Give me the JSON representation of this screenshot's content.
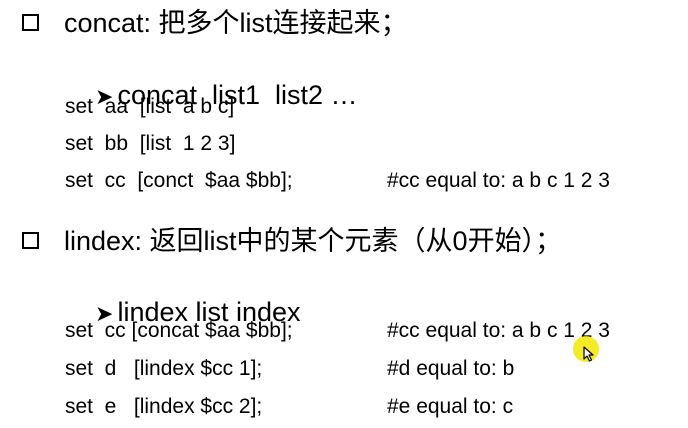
{
  "section1": {
    "heading": "concat: 把多个list连接起来；",
    "syntax": "concat  list1  list2 …",
    "lines": [
      {
        "code": "set  aa  [list  a b c]",
        "comment": ""
      },
      {
        "code": "set  bb  [list  1 2 3]",
        "comment": ""
      },
      {
        "code": "set  cc  [conct  $aa $bb];",
        "comment": "#cc equal to: a b c 1 2 3"
      }
    ]
  },
  "section2": {
    "heading": "lindex: 返回list中的某个元素（从0开始）；",
    "syntax": "lindex list index",
    "lines": [
      {
        "code": "set  cc [concat $aa $bb];",
        "comment": "#cc equal to: a b c 1 2 3"
      },
      {
        "code": "set  d   [lindex $cc 1];",
        "comment": "#d equal to: b"
      },
      {
        "code": "set  e   [lindex $cc 2];",
        "comment": "#e equal to: c"
      }
    ]
  },
  "icons": {
    "bullet": "checkbox-square-icon",
    "sub_bullet": "arrow-bullet-icon",
    "pointer": "mouse-cursor-icon",
    "highlight_color": "#f2e600"
  }
}
